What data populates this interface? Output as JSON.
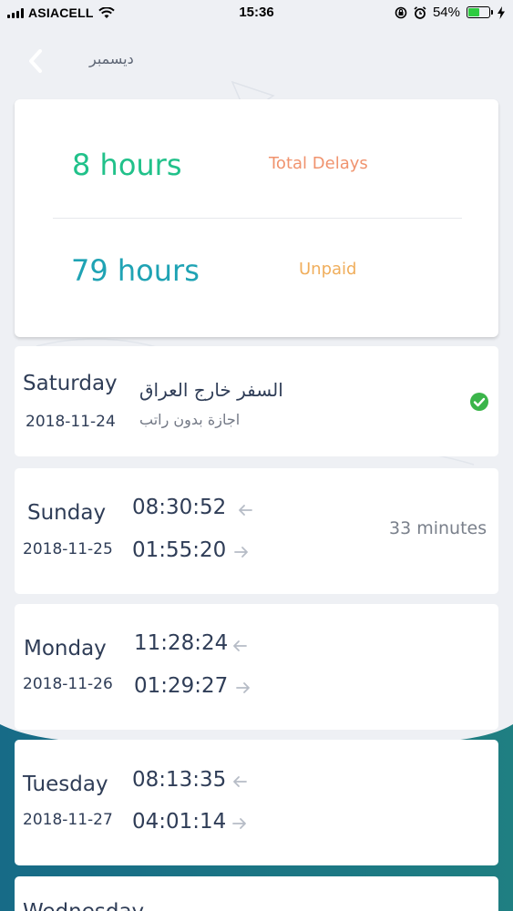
{
  "status_bar": {
    "carrier": "ASIACELL",
    "time": "15:36",
    "battery": "54%"
  },
  "header": {
    "title": "ديسمبر",
    "back_icon": "chevron-left-icon"
  },
  "summary": {
    "total_delays_value": "8 hours",
    "total_delays_label": "Total Delays",
    "unpaid_value": "79 hours",
    "unpaid_label": "Unpaid"
  },
  "days": [
    {
      "day": "Saturday",
      "date": "2018-11-24",
      "leave_title": "السفر خارج العراق",
      "leave_type": "اجازة بدون راتب",
      "status_icon": "check-circle-icon"
    },
    {
      "day": "Sunday",
      "date": "2018-11-25",
      "time_in": "08:30:52",
      "time_out": "01:55:20",
      "delay": "33 minutes"
    },
    {
      "day": "Monday",
      "date": "2018-11-26",
      "time_in": "11:28:24",
      "time_out": "01:29:27"
    },
    {
      "day": "Tuesday",
      "date": "2018-11-27",
      "time_in": "08:13:35",
      "time_out": "04:01:14"
    },
    {
      "day": "Wednesday"
    }
  ],
  "colors": {
    "delay_value": "#21c18a",
    "delay_label": "#f0936e",
    "unpaid_value": "#1fa3b4",
    "unpaid_label": "#f0ae5c",
    "check": "#3bb54a",
    "wave": "#1b6d87"
  }
}
